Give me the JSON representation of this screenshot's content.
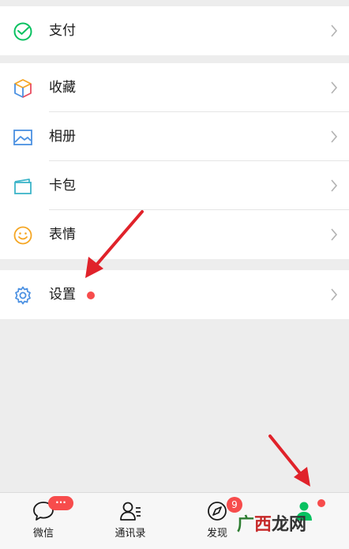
{
  "menu": {
    "pay": {
      "label": "支付"
    },
    "favorites": {
      "label": "收藏"
    },
    "album": {
      "label": "相册"
    },
    "cards": {
      "label": "卡包"
    },
    "stickers": {
      "label": "表情"
    },
    "settings": {
      "label": "设置"
    }
  },
  "tabbar": {
    "chats": {
      "label": "微信",
      "badge": "···"
    },
    "contacts": {
      "label": "通讯录"
    },
    "discover": {
      "label": "发现",
      "badge": "9"
    },
    "me": {
      "label": ""
    }
  },
  "watermark": {
    "part1": "广",
    "part2": "西",
    "part3": "龙网"
  },
  "colors": {
    "accent": "#07c160",
    "badge": "#f74c4c",
    "arrow": "#e0222a"
  }
}
